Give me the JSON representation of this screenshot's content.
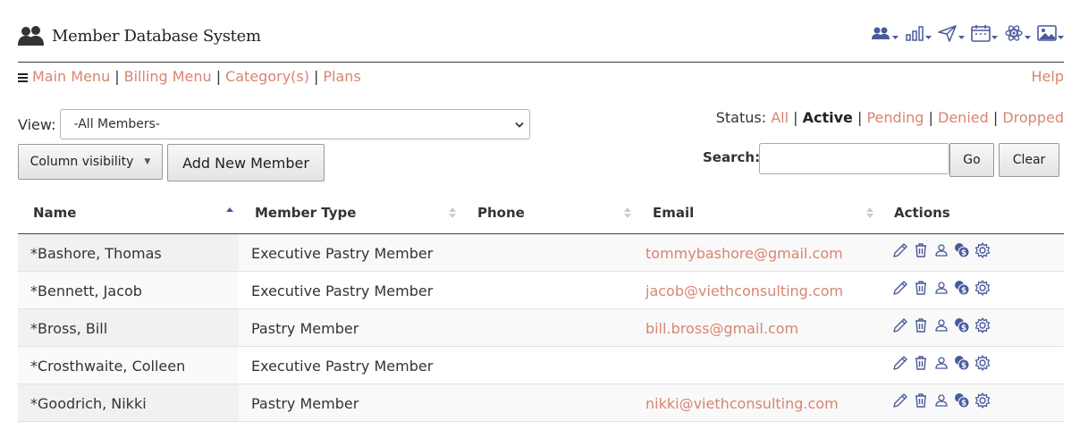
{
  "app": {
    "title": "Member Database System"
  },
  "toolbar": {
    "items": [
      {
        "icon": "users-icon"
      },
      {
        "icon": "bar-chart-icon"
      },
      {
        "icon": "send-icon"
      },
      {
        "icon": "calendar-icon"
      },
      {
        "icon": "atom-icon"
      },
      {
        "icon": "image-icon"
      }
    ]
  },
  "menu": {
    "main": "Main Menu",
    "billing": "Billing Menu",
    "category": "Category(s)",
    "plans": "Plans",
    "help": "Help",
    "separator": "|"
  },
  "view": {
    "label": "View:",
    "selected": "-All Members-"
  },
  "status": {
    "label": "Status:",
    "all": "All",
    "active": "Active",
    "pending": "Pending",
    "denied": "Denied",
    "dropped": "Dropped"
  },
  "buttons": {
    "column_visibility": "Column visibility",
    "add_new": "Add New Member",
    "go": "Go",
    "clear": "Clear"
  },
  "search": {
    "label": "Search:",
    "value": ""
  },
  "table": {
    "columns": [
      "Name",
      "Member Type",
      "Phone",
      "Email",
      "Actions"
    ],
    "rows": [
      {
        "name": "*Bashore, Thomas",
        "type": "Executive Pastry Member",
        "phone": "",
        "email": "tommybashore@gmail.com"
      },
      {
        "name": "*Bennett, Jacob",
        "type": "Executive Pastry Member",
        "phone": "",
        "email": "jacob@viethconsulting.com"
      },
      {
        "name": "*Bross, Bill",
        "type": "Pastry Member",
        "phone": "",
        "email": "bill.bross@gmail.com"
      },
      {
        "name": "*Crosthwaite, Colleen",
        "type": "Executive Pastry Member",
        "phone": "",
        "email": ""
      },
      {
        "name": "*Goodrich, Nikki",
        "type": "Pastry Member",
        "phone": "",
        "email": "nikki@viethconsulting.com"
      }
    ]
  },
  "colors": {
    "accent": "#d98470",
    "icon": "#4a5a9c",
    "text": "#333333"
  }
}
